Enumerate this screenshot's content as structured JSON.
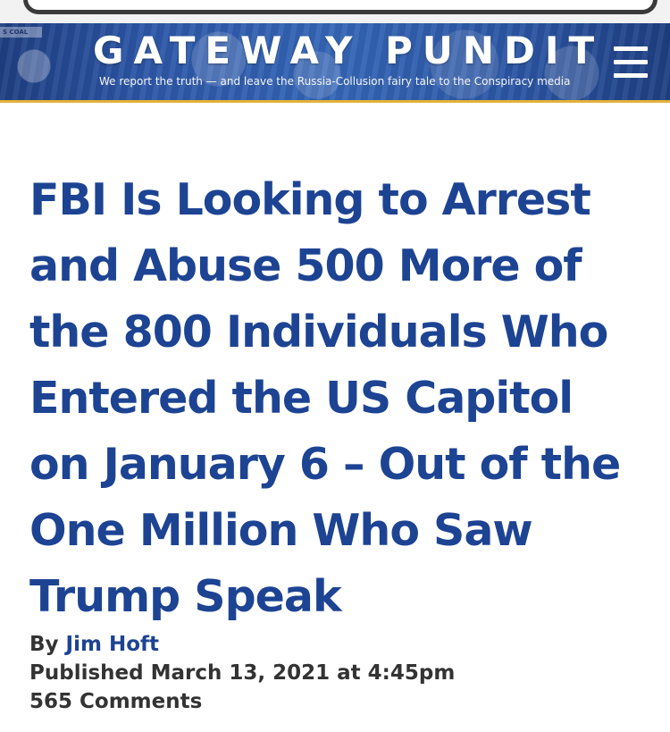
{
  "site": {
    "title": "GATEWAY PUNDIT",
    "tagline": "We report the truth — and leave the Russia-Collusion fairy tale to the Conspiracy media",
    "banner_sign_text": "S COAL",
    "menu_icon": "hamburger-menu-icon"
  },
  "article": {
    "headline": "FBI Is Looking to Arrest and Abuse 500 More of the 800 Individuals Who Entered the US Capitol on January 6 – Out of the One Million Who Saw Trump Speak",
    "by_label": "By",
    "author": "Jim Hoft",
    "published": "Published March 13, 2021 at 4:45pm",
    "comments": "565 Comments"
  },
  "colors": {
    "headline": "#1d4393",
    "banner": "#2d57a8",
    "accent_underline": "#e3b23a",
    "meta_text": "#333333"
  }
}
